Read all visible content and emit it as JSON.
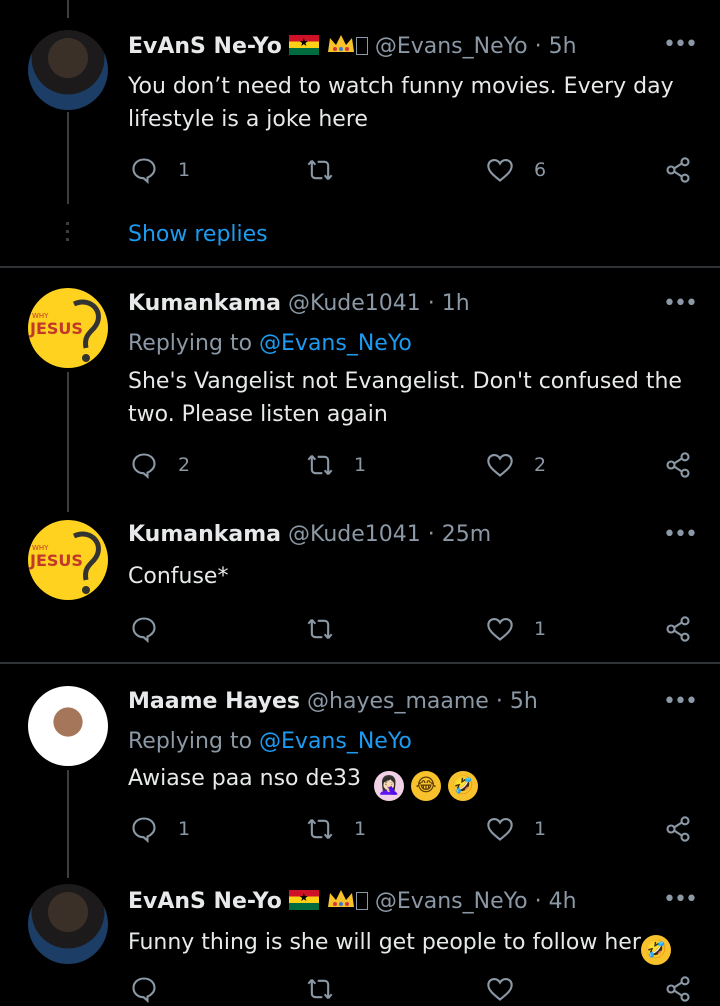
{
  "tweets": [
    {
      "name": "EvAnS Ne-Yo",
      "handle": "@Evans_NeYo",
      "time": "· 5h",
      "body": "You don’t need to watch funny movies. Every day lifestyle is a joke here",
      "replies": "1",
      "retweets": "",
      "likes": "6"
    },
    {
      "name": "Kumankama",
      "handle": "@Kude1041",
      "time": "· 1h",
      "replying_label": "Replying to",
      "replying_to": "@Evans_NeYo",
      "body": "She's Vangelist not Evangelist. Don't confused the two. Please listen again",
      "replies": "2",
      "retweets": "1",
      "likes": "2"
    },
    {
      "name": "Kumankama",
      "handle": "@Kude1041",
      "time": "· 25m",
      "body": "Confuse*",
      "replies": "",
      "retweets": "",
      "likes": "1"
    },
    {
      "name": "Maame Hayes",
      "handle": "@hayes_maame",
      "time": "· 5h",
      "replying_label": "Replying to",
      "replying_to": "@Evans_NeYo",
      "body": "Awiase paa nso de33",
      "replies": "1",
      "retweets": "1",
      "likes": "1"
    },
    {
      "name": "EvAnS Ne-Yo",
      "handle": "@Evans_NeYo",
      "time": "· 4h",
      "body": "Funny thing is she will get people to follow her",
      "replies": "",
      "retweets": "",
      "likes": ""
    }
  ],
  "show_replies": "Show replies",
  "avatar_text": {
    "why": "WHY",
    "jesus": "JESUS"
  },
  "emojis": [
    "🤦🏻‍♀️",
    "😂",
    "🤣"
  ],
  "colors": {
    "background": "#000000",
    "link": "#1d9bf0",
    "muted": "#8b98a5",
    "divider": "#2f3336"
  },
  "icons": [
    "reply-icon",
    "retweet-icon",
    "like-icon",
    "share-icon",
    "more-icon",
    "ghana-flag-icon",
    "crown-icon"
  ]
}
